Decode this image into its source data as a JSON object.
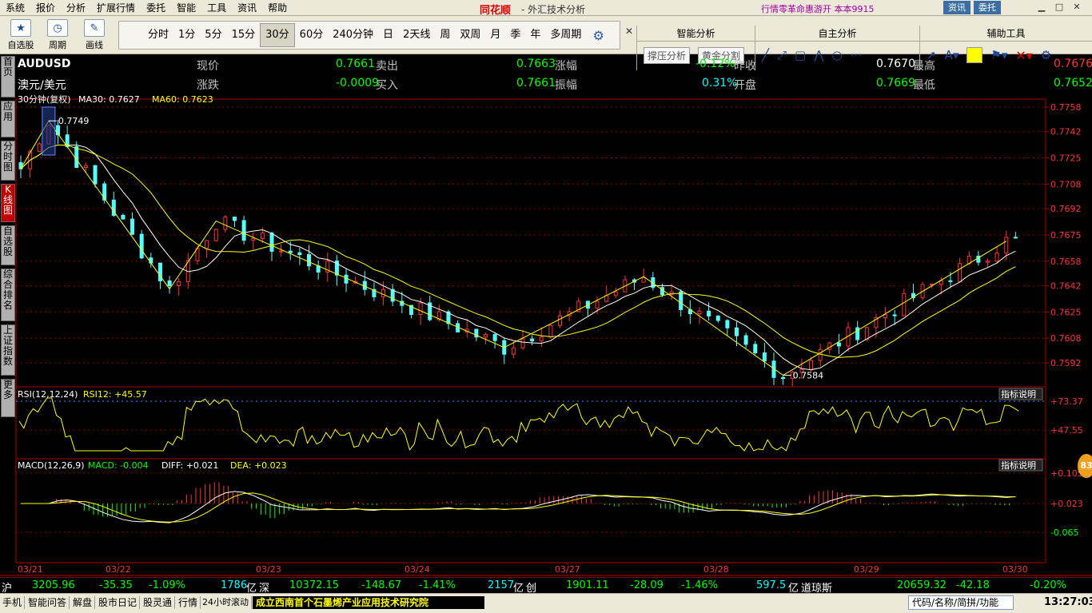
{
  "menu": {
    "items": [
      "系统",
      "报价",
      "分析",
      "扩展行情",
      "委托",
      "智能",
      "工具",
      "资讯",
      "帮助"
    ],
    "brand": "同花顺",
    "title": "- 外汇技术分析",
    "ticker": "行情零革命惠游开   本本9915",
    "btn_news": "资讯",
    "btn_trade": "委托"
  },
  "toolbar": {
    "autoselect": "自选股",
    "period": "周期",
    "draw": "画线",
    "periods": [
      "分时",
      "1分",
      "5分",
      "15分",
      "30分",
      "60分",
      "240分钟",
      "日",
      "2天线",
      "周",
      "双周",
      "月",
      "季",
      "年",
      "多周期"
    ],
    "active_period": "30分"
  },
  "panels": {
    "smart": {
      "title": "智能分析",
      "btn1": "撑压分析",
      "btn2": "黄金分割"
    },
    "self": {
      "title": "自主分析"
    },
    "aux": {
      "title": "辅助工具"
    }
  },
  "sidetabs": [
    "首页",
    "应用",
    "分时图",
    "K线图",
    "自选股",
    "综合排名",
    "上证指数",
    "更多"
  ],
  "quote": {
    "symbol": "AUDUSD",
    "name": "澳元/美元",
    "now_label": "现价",
    "now": "0.7661",
    "chg_label": "涨跌",
    "chg": "-0.0009",
    "sell_label": "卖出",
    "sell": "0.7663",
    "buy_label": "买入",
    "buy": "0.7661",
    "pct_label": "涨幅",
    "pct": "-0.12%",
    "amp_label": "振幅",
    "amp": "0.31%",
    "prev_label": "昨收",
    "prev": "0.7670",
    "open_label": "开盘",
    "open": "0.7669",
    "high_label": "最高",
    "high": "0.7676",
    "low_label": "最低",
    "low": "0.7652"
  },
  "indicators": {
    "main_label": "30分钟(复权)",
    "ma30": "MA30: 0.7627",
    "ma60": "MA60: 0.7623",
    "rsi_label": "RSI(12,12,24)",
    "rsi_val": "RSI12: +45.57",
    "macd_label": "MACD(12,26,9)",
    "macd_val": "MACD: -0.004",
    "diff_val": "DIFF: +0.021",
    "dea_val": "DEA: +0.023",
    "help": "指标说明"
  },
  "colors": {
    "up": "#ff3232",
    "down": "#54ffff",
    "ma30": "#ffffff",
    "ma60": "#ffff00",
    "zig": "#ffff00",
    "grid": "#8b0000"
  },
  "chart_data": {
    "type": "candlestick",
    "y_ticks": [
      "0.7758",
      "0.7742",
      "0.7725",
      "0.7708",
      "0.7692",
      "0.7675",
      "0.7658",
      "0.7642",
      "0.7625",
      "0.7608",
      "0.7592"
    ],
    "ylim": [
      0.7577,
      0.776
    ],
    "x_labels": [
      "03/21",
      "03/22",
      "03/23",
      "03/24",
      "03/27",
      "03/28",
      "03/29",
      "03/30"
    ],
    "high_label": "0.7749",
    "low_label": "0.7584",
    "rsi_ticks": [
      "+73.37",
      "+47.55"
    ],
    "macd_ticks": [
      "+0.105",
      "+0.023",
      "-0.065"
    ],
    "zigzag": [
      [
        0,
        0.7718
      ],
      [
        3,
        0.7749
      ],
      [
        16,
        0.764
      ],
      [
        21,
        0.7684
      ],
      [
        52,
        0.7602
      ],
      [
        67,
        0.7648
      ],
      [
        82,
        0.7584
      ],
      [
        106,
        0.7671
      ]
    ]
  },
  "status": {
    "sh_label": "沪",
    "sh": "3205.96",
    "sh_chg": "-35.35",
    "sh_pct": "-1.09%",
    "sh_amt": "1786",
    "yi": "亿",
    "sz_label": "深",
    "sz": "10372.15",
    "sz_chg": "-148.67",
    "sz_pct": "-1.41%",
    "sz_amt": "2157",
    "cy_label": "创",
    "cy": "1901.11",
    "cy_chg": "-28.09",
    "cy_pct": "-1.46%",
    "cy_amt": "597.5",
    "dj_label": "道琼斯",
    "dj": "20659.32",
    "dj_chg": "-42.18",
    "dj_pct": "-0.20%"
  },
  "taskbar": {
    "items": [
      "手机",
      "智能问答",
      "解盘",
      "股市日记",
      "股灵通",
      "行情",
      "24小时滚动"
    ],
    "news": "成立西南首个石墨烯产业应用技术研究院",
    "search": "代码/名称/简拼/功能",
    "clock": "13:27:03",
    "badge": "83"
  }
}
